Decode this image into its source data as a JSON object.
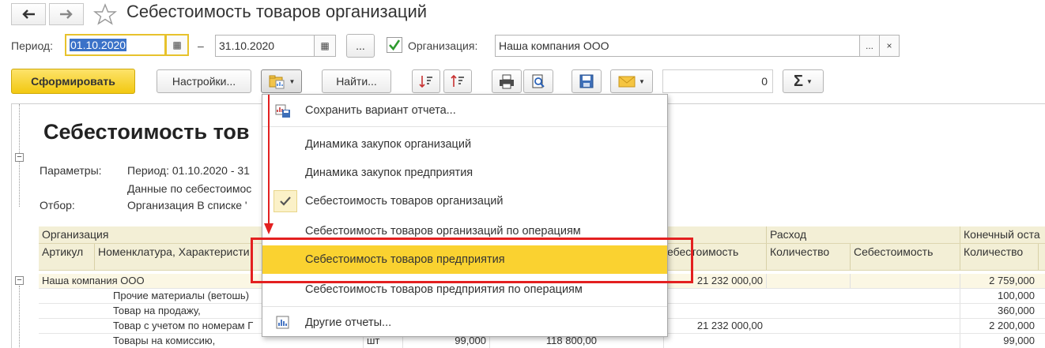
{
  "window": {
    "title": "Себестоимость товаров организаций"
  },
  "filters": {
    "period_label": "Период:",
    "period_from": "01.10.2020",
    "dash": "–",
    "period_to": "31.10.2020",
    "ellipsis": "...",
    "org_label": "Организация:",
    "org_value": "Наша компания ООО",
    "org_checked": true
  },
  "toolbar": {
    "generate": "Сформировать",
    "settings": "Настройки...",
    "find": "Найти...",
    "counter": "0",
    "sigma": "Σ"
  },
  "report": {
    "title": "Себестоимость тов",
    "params_label": "Параметры:",
    "params_line1": "Период: 01.10.2020 - 31",
    "params_line2": "Данные по себестоимос",
    "filter_label": "Отбор:",
    "filter_line": "Организация В списке '",
    "header1": {
      "org": "Организация",
      "expense": "Расход",
      "end_balance": "Конечный оста"
    },
    "header2": {
      "article": "Артикул",
      "nomenclature": "Номенклатура, Характеристи",
      "cost": "ебестоимость",
      "qty": "Количество",
      "cost2": "Себестоимость",
      "qty2": "Количество"
    },
    "rows": [
      {
        "name": "Наша компания ООО",
        "cost": "21 232 000,00",
        "end_qty": "2 759,000"
      },
      {
        "name": "Прочие материалы (ветошь)",
        "end_qty": "100,000"
      },
      {
        "name": "Товар на продажу,",
        "end_qty": "360,000"
      },
      {
        "name": "Товар с учетом по номерам Г",
        "cost": "21 232 000,00",
        "end_qty": "2 200,000"
      },
      {
        "name": "Товары на комиссию,",
        "unit": "шт",
        "q": "99,000",
        "c": "118 800,00",
        "end_qty": "99,000"
      }
    ]
  },
  "menu": {
    "items": [
      {
        "label": "Сохранить вариант отчета..."
      },
      {
        "label": "Динамика закупок организаций"
      },
      {
        "label": "Динамика закупок предприятия"
      },
      {
        "label": "Себестоимость товаров организаций",
        "checked": true
      },
      {
        "label": "Себестоимость товаров организаций по операциям"
      },
      {
        "label": "Себестоимость товаров предприятия",
        "highlighted": true
      },
      {
        "label": "Себестоимость товаров предприятия по операциям"
      },
      {
        "label": "Другие отчеты..."
      }
    ]
  },
  "colors": {
    "accent_yellow": "#f6d53a",
    "highlight": "#fad230",
    "annotation_red": "#e32020",
    "header_bg": "#f3efd6"
  }
}
